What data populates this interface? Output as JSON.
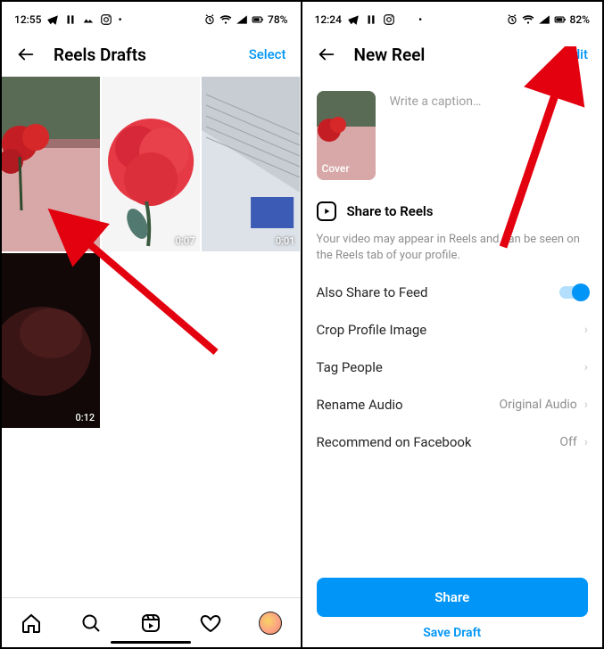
{
  "left": {
    "status": {
      "time": "12:55",
      "battery": "78%"
    },
    "title": "Reels Drafts",
    "select": "Select",
    "drafts": [
      {
        "duration": ""
      },
      {
        "duration": "0:07"
      },
      {
        "duration": "0:01"
      },
      {
        "duration": "0:12"
      }
    ]
  },
  "right": {
    "status": {
      "time": "12:24",
      "battery": "82%"
    },
    "title": "New Reel",
    "edit": "Edit",
    "cover_label": "Cover",
    "caption_placeholder": "Write a caption…",
    "share_to_reels": "Share to Reels",
    "share_subtext": "Your video may appear in Reels and can be seen on the Reels tab of your profile.",
    "also_share_feed": "Also Share to Feed",
    "crop_profile": "Crop Profile Image",
    "tag_people": "Tag People",
    "rename_audio": "Rename Audio",
    "rename_audio_value": "Original Audio",
    "recommend_fb": "Recommend on Facebook",
    "recommend_fb_value": "Off",
    "share_btn": "Share",
    "save_draft": "Save Draft"
  }
}
